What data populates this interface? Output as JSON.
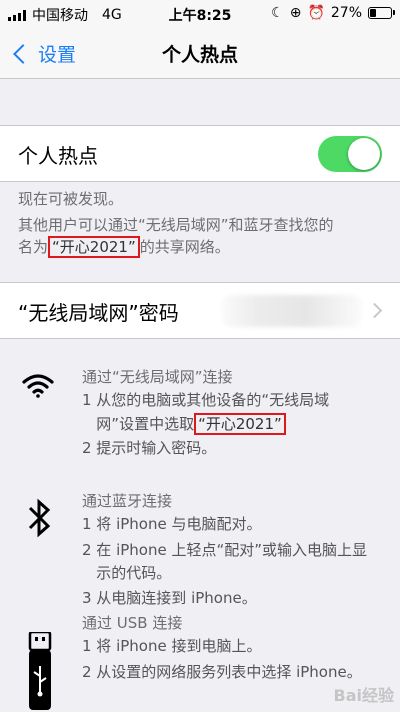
{
  "status_bar": {
    "carrier": "中国移动",
    "network": "4G",
    "time": "上午8:25",
    "battery_percent": "27%",
    "battery_level": 0.27
  },
  "nav": {
    "back_label": "设置",
    "title": "个人热点"
  },
  "hotspot": {
    "label": "个人热点",
    "enabled": true
  },
  "info": {
    "line1": "现在可被发现。",
    "line2": "其他用户可以通过“无线局域网”和蓝牙查找您的",
    "line3_prefix": "名为",
    "network_name": "“开心2021”",
    "line3_suffix": "的共享网络。"
  },
  "password_row": {
    "label": "“无线局域网”密码"
  },
  "wifi_section": {
    "icon": "wifi-icon",
    "title": "通过“无线局域网”连接",
    "step1_a": "1 从您的电脑或其他设备的“无线局域",
    "step1_b_prefix": "   网”设置中选取",
    "network_name": "“开心2021”",
    "step2": "2 提示时输入密码。"
  },
  "bluetooth_section": {
    "icon": "bluetooth-icon",
    "title": "通过蓝牙连接",
    "step1": "1 将 iPhone 与电脑配对。",
    "step2_a": "2 在 iPhone 上轻点“配对”或输入电脑上显",
    "step2_b": "   示的代码。",
    "step3": "3 从电脑连接到 iPhone。"
  },
  "usb_section": {
    "icon": "usb-icon",
    "title": "通过 USB 连接",
    "step1": "1 将 iPhone 接到电脑上。",
    "step2": "2 从设置的网络服务列表中选择 iPhone。"
  },
  "watermark": "Bai经验",
  "colors": {
    "accent": "#1a7ef7",
    "toggle_on": "#4cd964",
    "highlight_box": "#e0171d",
    "background": "#efeff4"
  }
}
